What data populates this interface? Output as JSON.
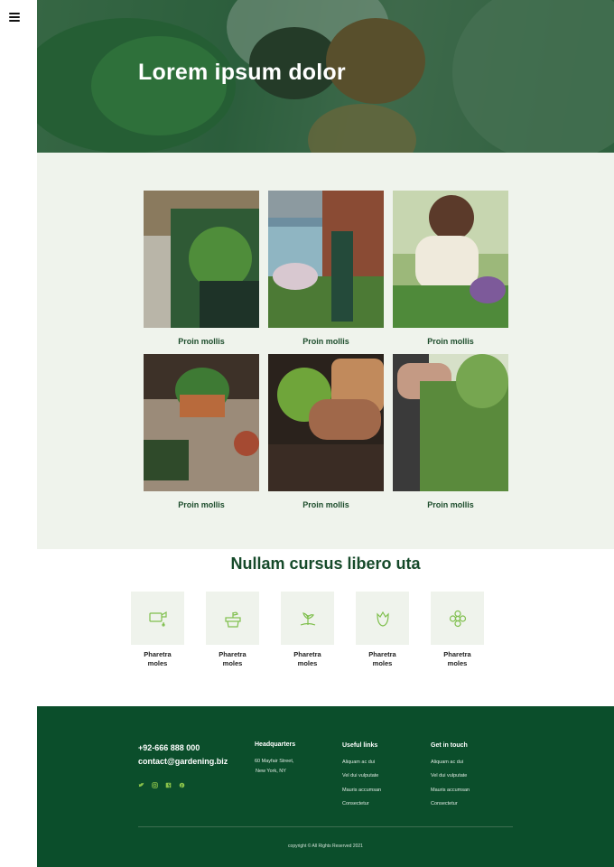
{
  "hero": {
    "title": "Lorem ipsum dolor"
  },
  "gallery": {
    "items": [
      {
        "caption": "Proin mollis"
      },
      {
        "caption": "Proin mollis"
      },
      {
        "caption": "Proin mollis"
      },
      {
        "caption": "Proin mollis"
      },
      {
        "caption": "Proin mollis"
      },
      {
        "caption": "Proin mollis"
      }
    ]
  },
  "features": {
    "title": "Nullam cursus libero uta",
    "items": [
      {
        "label": "Pharetra\nmoles",
        "icon": "watering-can-icon"
      },
      {
        "label": "Pharetra\nmoles",
        "icon": "potted-plant-icon"
      },
      {
        "label": "Pharetra\nmoles",
        "icon": "seedling-icon"
      },
      {
        "label": "Pharetra\nmoles",
        "icon": "tulip-icon"
      },
      {
        "label": "Pharetra\nmoles",
        "icon": "flower-icon"
      }
    ]
  },
  "footer": {
    "phone": "+92-666 888 000",
    "email": "contact@gardening.biz",
    "socials": [
      "twitter-icon",
      "instagram-icon",
      "facebook-icon",
      "pinterest-icon"
    ],
    "headquarters": {
      "title": "Headquarters",
      "line1": "60  Mayfair Street,",
      "line2": "New York, NY"
    },
    "useful_links": {
      "title": "Useful links",
      "items": [
        "Aliquam ac dui",
        "Vel dui vulputate",
        "Mauris accumsan",
        "Consectetur"
      ]
    },
    "get_in_touch": {
      "title": "Get in touch",
      "items": [
        "Aliquam ac dui",
        "Vel dui vulputate",
        "Mauris accumsan",
        "Consectetur"
      ]
    },
    "copyright": "copyright © All Rights Reserved 2021"
  },
  "colors": {
    "accent": "#0b4e2b",
    "icon_green": "#7fbf4d",
    "panel": "#eff3ec"
  }
}
